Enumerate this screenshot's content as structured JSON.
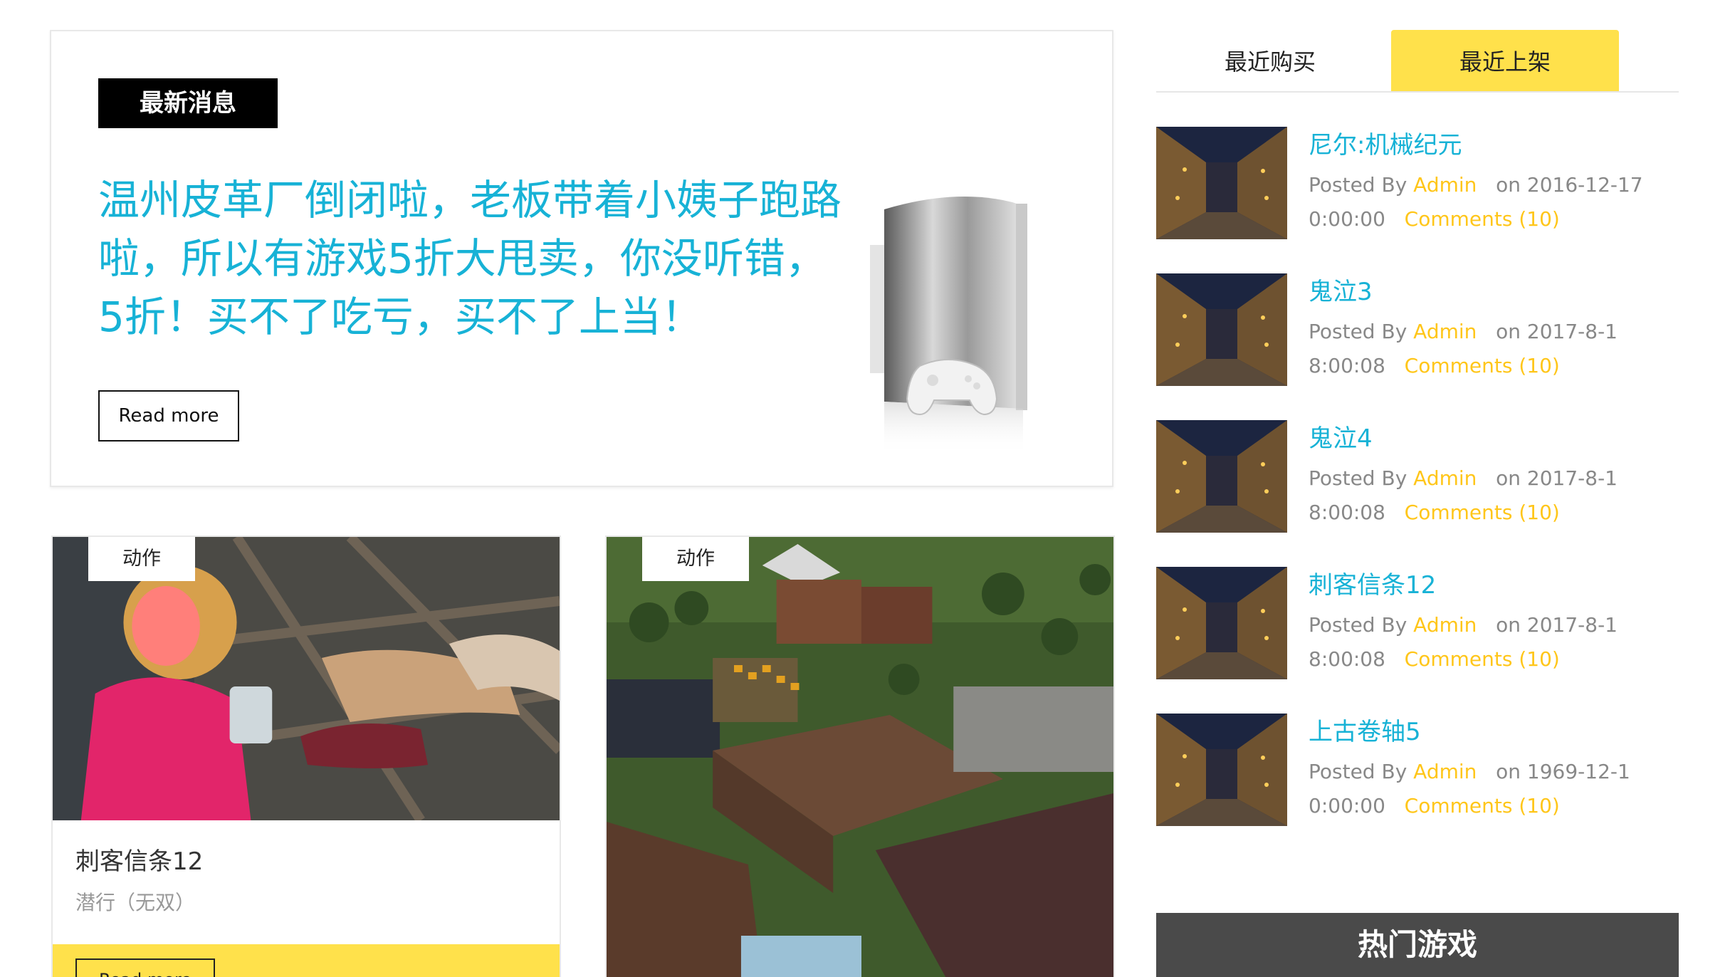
{
  "featured": {
    "badge": "最新消息",
    "headline": "温州皮革厂倒闭啦，老板带着小姨子跑路啦，所以有游戏5折大甩卖，你没听错，5折！买不了吃亏，买不了上当！",
    "read_more": "Read more"
  },
  "cards": [
    {
      "tag": "动作",
      "title": "刺客信条12",
      "subtitle": "潜行（无双）",
      "button": "Read more"
    },
    {
      "tag": "动作"
    }
  ],
  "sidebar": {
    "tabs": [
      "最近购买",
      "最近上架"
    ],
    "active_tab": "最近上架",
    "items": [
      {
        "title": "尼尔:机械纪元",
        "posted_by": "Posted By",
        "author": "Admin",
        "date": "on 2016-12-17",
        "time": "0:00:00",
        "comments": "Comments (10)"
      },
      {
        "title": "鬼泣3",
        "posted_by": "Posted By",
        "author": "Admin",
        "date": "on 2017-8-1",
        "time": "8:00:08",
        "comments": "Comments (10)"
      },
      {
        "title": "鬼泣4",
        "posted_by": "Posted By",
        "author": "Admin",
        "date": "on 2017-8-1",
        "time": "8:00:08",
        "comments": "Comments (10)"
      },
      {
        "title": "刺客信条12",
        "posted_by": "Posted By",
        "author": "Admin",
        "date": "on 2017-8-1",
        "time": "8:00:08",
        "comments": "Comments (10)"
      },
      {
        "title": "上古卷轴5",
        "posted_by": "Posted By",
        "author": "Admin",
        "date": "on 1969-12-1",
        "time": "0:00:00",
        "comments": "Comments (10)"
      }
    ],
    "hot_header": "热门游戏"
  },
  "colors": {
    "accent_cyan": "#17b2d6",
    "accent_yellow": "#ffe14b",
    "meta_yellow": "#ffc61a",
    "dark_header": "#4a4a4a"
  }
}
